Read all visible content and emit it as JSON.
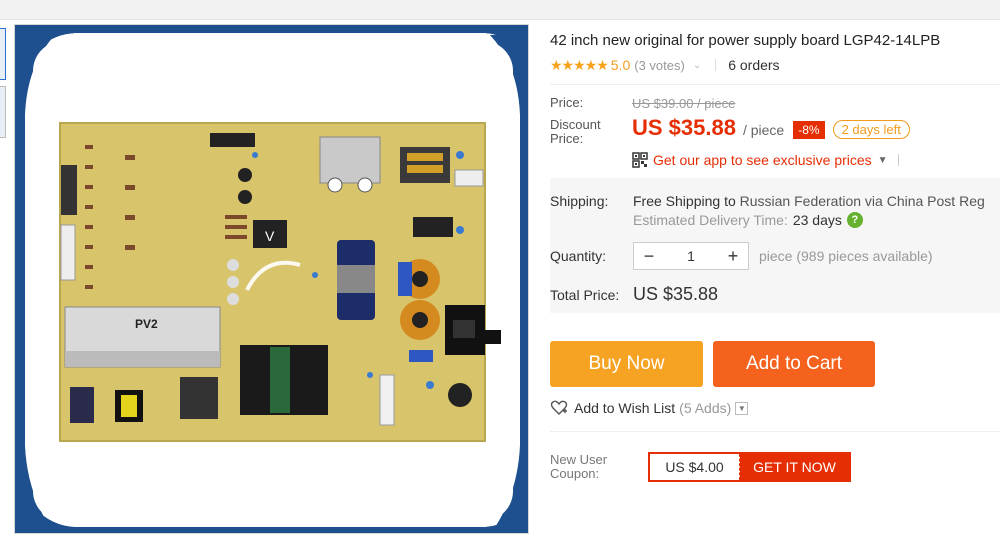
{
  "product": {
    "title": "42 inch new original for power supply board LGP42-14LPB",
    "stars": "★★★★★",
    "rating": "5.0",
    "votes": "(3 votes)",
    "orders": "6 orders",
    "board_label": "PV2"
  },
  "pricing": {
    "price_label": "Price:",
    "original_price": "US $39.00 / piece",
    "discount_label": "Discount Price:",
    "discount_price": "US $35.88",
    "per_piece": "/ piece",
    "discount_pct": "-8%",
    "days_left": "2 days left",
    "app_promo": "Get our app to see exclusive prices"
  },
  "shipping": {
    "label": "Shipping:",
    "free_text": "Free Shipping",
    "to": "to",
    "destination": "Russian Federation via China Post Reg",
    "eta_label": "Estimated Delivery Time:",
    "eta_value": "23  days"
  },
  "quantity": {
    "label": "Quantity:",
    "minus": "−",
    "value": "1",
    "plus": "+",
    "available": "piece (989 pieces available)"
  },
  "total": {
    "label": "Total Price:",
    "value": "US $35.88"
  },
  "actions": {
    "buy_now": "Buy Now",
    "add_to_cart": "Add to Cart",
    "wish_list": "Add to Wish List",
    "wish_count": "(5 Adds)"
  },
  "coupon": {
    "label": "New User Coupon:",
    "value": "US $4.00",
    "cta": "GET IT NOW"
  },
  "colors": {
    "accent_red": "#e62e04",
    "buy_orange": "#f6a323",
    "cart_orange": "#f5621e",
    "star_gold": "#f7a21b",
    "gallery_blue": "#1e4f8f",
    "pcb_yellow": "#d8c46a"
  }
}
